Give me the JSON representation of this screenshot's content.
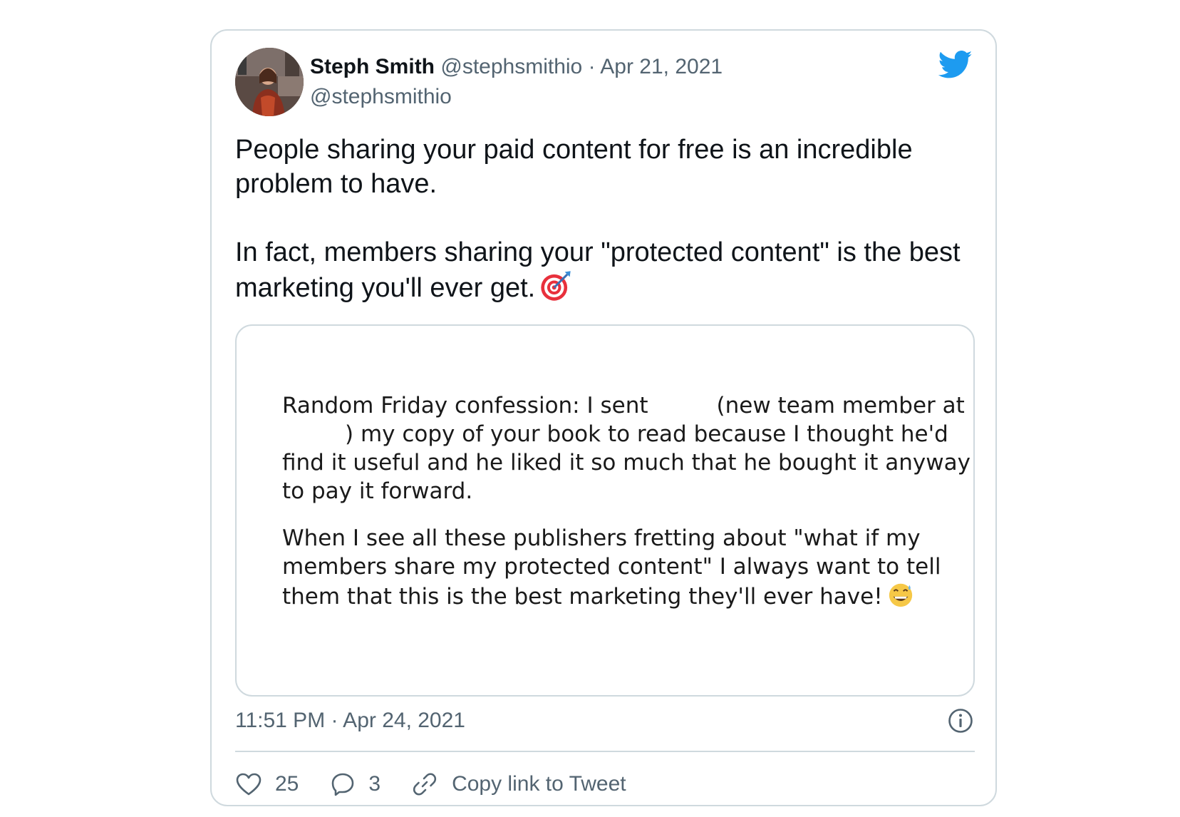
{
  "tweet": {
    "author": {
      "display_name": "Steph Smith",
      "handle": "@stephsmithio",
      "separator": "·",
      "date": "Apr 21, 2021",
      "handle_line": "@stephsmithio"
    },
    "logo_icon": "twitter-bird-icon",
    "text": {
      "paragraph_1": "People sharing your paid content for free is an incredible problem to have.",
      "paragraph_2": "In fact, members sharing your \"protected content\" is the best marketing you'll ever get.",
      "emoji": "direct-hit-icon"
    },
    "media": {
      "line_1a": "Random Friday confession: I sent",
      "line_1b": "(new team member at",
      "line_2": ") my copy of your book to read because I thought he'd",
      "line_3": "find it useful and he liked it so much that he bought it anyway",
      "line_4": "to pay it forward.",
      "line_5": "When I see all these publishers fretting about \"what if my",
      "line_6": "members share my protected content\" I always want to tell",
      "line_7": "them that this is the best marketing they'll ever have!",
      "emoji": "grinning-face-with-sweat-icon"
    },
    "timestamp": "11:51 PM · Apr 24, 2021",
    "info_icon": "info-icon",
    "actions": {
      "likes": {
        "icon": "heart-icon",
        "count": "25"
      },
      "replies": {
        "icon": "reply-bubble-icon",
        "count": "3"
      },
      "copy_link": {
        "icon": "link-icon",
        "label": "Copy link to Tweet"
      }
    },
    "colors": {
      "text_primary": "#0f1419",
      "text_secondary": "#536471",
      "border": "#cfd9de",
      "twitter_blue": "#1d9bf0"
    }
  }
}
